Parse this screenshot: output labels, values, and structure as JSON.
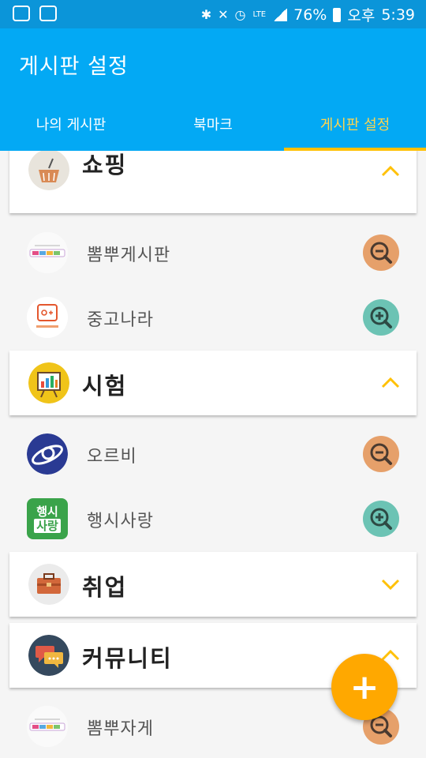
{
  "status_bar": {
    "battery": "76%",
    "ampm": "오후",
    "time": "5:39",
    "network": "LTE"
  },
  "app_bar": {
    "title": "게시판 설정",
    "tabs": [
      {
        "label": "나의 게시판",
        "active": false
      },
      {
        "label": "북마크",
        "active": false
      },
      {
        "label": "게시판 설정",
        "active": true
      }
    ]
  },
  "categories": [
    {
      "label": "쇼핑",
      "icon": "shopping-basket-icon",
      "expanded": true
    },
    {
      "label": "시험",
      "icon": "presentation-board-icon",
      "expanded": true
    },
    {
      "label": "취업",
      "icon": "briefcase-icon",
      "expanded": false
    },
    {
      "label": "커뮤니티",
      "icon": "chat-bubbles-icon",
      "expanded": true
    }
  ],
  "boards": [
    {
      "label": "뽐뿌게시판",
      "logo": "ppomppu-logo",
      "action": "remove"
    },
    {
      "label": "중고나라",
      "logo": "joongonara-logo",
      "action": "add"
    },
    {
      "label": "오르비",
      "logo": "orbi-logo",
      "action": "remove"
    },
    {
      "label": "행시사랑",
      "logo": "haengsisarang-logo",
      "action": "add",
      "logo_text_top": "행시",
      "logo_text_bottom": "사랑"
    },
    {
      "label": "뽐뿌자게",
      "logo": "ppomppu-logo",
      "action": "remove"
    }
  ],
  "fab": {
    "icon": "plus-icon",
    "label": "+"
  },
  "colors": {
    "status_bar": "#0b95d9",
    "app_bar": "#03a9f4",
    "accent": "#ffc107",
    "remove_button": "#e6a06a",
    "add_button": "#6cc3b4",
    "fab": "#ffa800"
  }
}
